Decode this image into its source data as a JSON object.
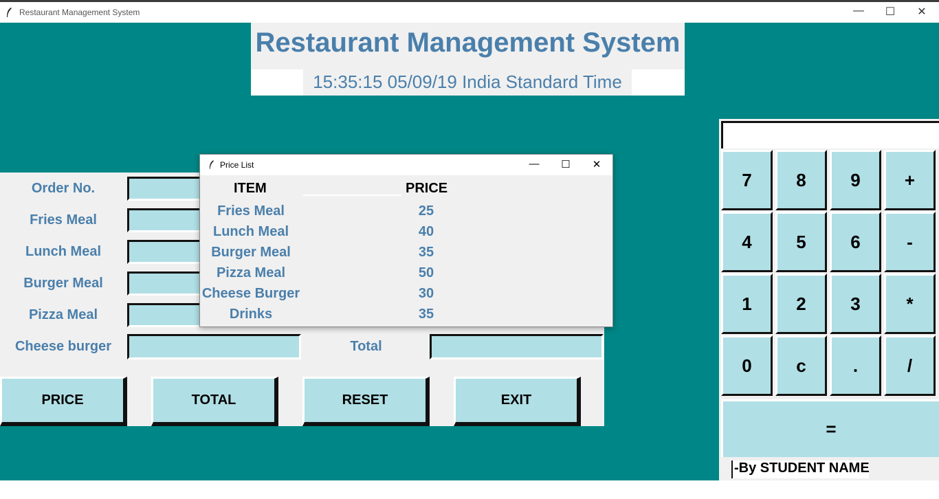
{
  "window": {
    "title": "Restaurant Management System",
    "minimize": "—",
    "maximize": "☐",
    "close": "✕"
  },
  "header": {
    "title": "Restaurant Management System",
    "clock": "15:35:15 05/09/19 India Standard Time"
  },
  "form": {
    "fields": [
      {
        "label": "Order No.",
        "value": ""
      },
      {
        "label": "Fries Meal",
        "value": ""
      },
      {
        "label": "Lunch Meal",
        "value": ""
      },
      {
        "label": "Burger Meal",
        "value": ""
      },
      {
        "label": "Pizza Meal",
        "value": ""
      },
      {
        "label": "Cheese burger",
        "value": ""
      }
    ],
    "total_label": "Total",
    "total_value": ""
  },
  "buttons": {
    "price": "PRICE",
    "total": "TOTAL",
    "reset": "RESET",
    "exit": "EXIT"
  },
  "calculator": {
    "display": "",
    "keys": [
      "7",
      "8",
      "9",
      "+",
      "4",
      "5",
      "6",
      "-",
      "1",
      "2",
      "3",
      "*",
      "0",
      "c",
      ".",
      "/"
    ],
    "equals": "=",
    "credit": "-By STUDENT NAME"
  },
  "price_list": {
    "title": "Price List",
    "item_header": "ITEM",
    "price_header": "PRICE",
    "items": [
      {
        "name": "Fries Meal",
        "price": "25"
      },
      {
        "name": "Lunch Meal",
        "price": "40"
      },
      {
        "name": "Burger Meal",
        "price": "35"
      },
      {
        "name": "Pizza Meal",
        "price": "50"
      },
      {
        "name": "Cheese Burger",
        "price": "30"
      },
      {
        "name": "Drinks",
        "price": "35"
      }
    ]
  },
  "colors": {
    "background": "#008686",
    "panel": "#f0f0f0",
    "entry": "#b0dfe5",
    "label_text": "#4a7fab"
  }
}
